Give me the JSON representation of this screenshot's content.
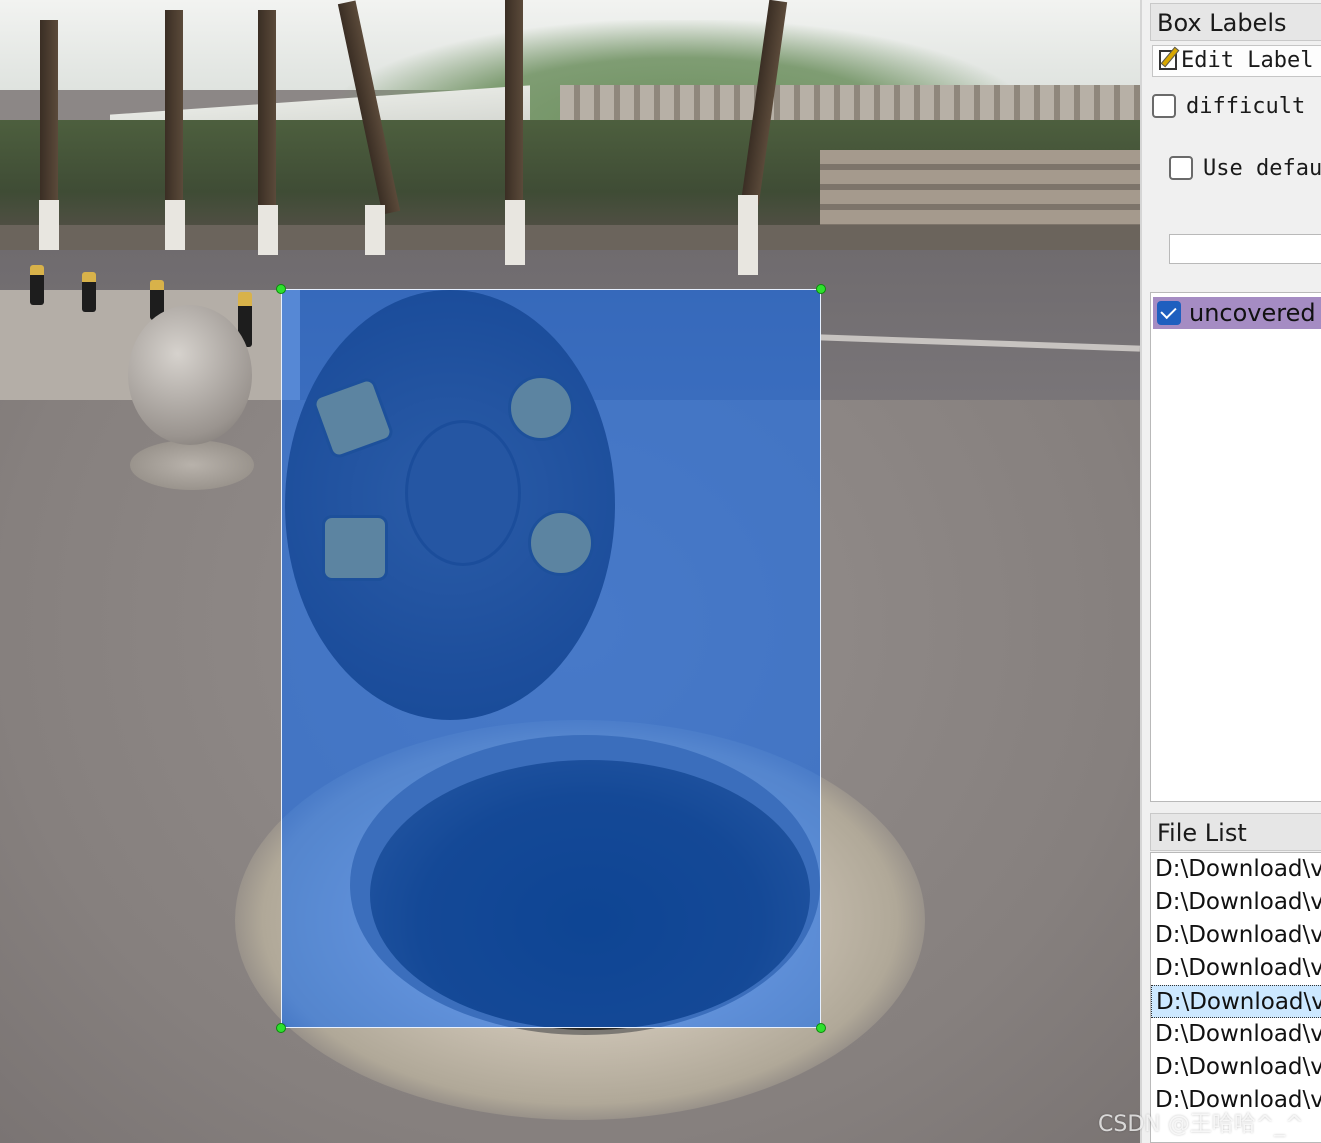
{
  "canvas": {
    "annotation": {
      "label": "uncovered",
      "fill_color": "#0066ff",
      "vertex_color": "#2ee02e"
    }
  },
  "box_labels": {
    "title": "Box Labels",
    "edit_label": "Edit Label",
    "difficult_label": "difficult",
    "difficult_checked": false,
    "use_default_label": "Use defaul",
    "use_default_checked": false,
    "default_label_value": "",
    "labels": [
      {
        "text": "uncovered",
        "checked": true
      }
    ]
  },
  "file_list": {
    "title": "File List",
    "items": [
      "D:\\Download\\v",
      "D:\\Download\\v",
      "D:\\Download\\v",
      "D:\\Download\\v",
      "D:\\Download\\v",
      "D:\\Download\\v",
      "D:\\Download\\v",
      "D:\\Download\\v"
    ],
    "selected_index": 4
  },
  "watermark": "CSDN @王哈哈^_^"
}
